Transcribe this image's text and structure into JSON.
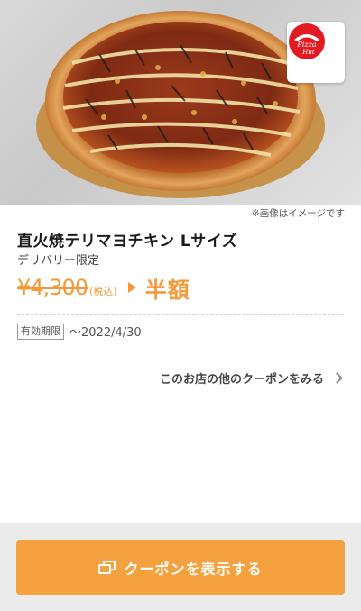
{
  "hero": {
    "image_note": "※画像はイメージです",
    "logo_name": "pizza-hut-logo",
    "logo_text_line1": "Pizza",
    "logo_text_line2": "Hut"
  },
  "product": {
    "name": "直火焼テリマヨチキン Lサイズ",
    "restriction": "デリバリー限定"
  },
  "price": {
    "original": "¥4,300",
    "tax_note": "(税込)",
    "discount": "半額",
    "accent_color": "#f29a38"
  },
  "expiry": {
    "label": "有効期限",
    "date": "〜2022/4/30"
  },
  "links": {
    "other_coupons": "このお店の他のクーポンをみる"
  },
  "footer": {
    "show_coupon_label": "クーポンを表示する",
    "button_color": "#f4a13f"
  }
}
